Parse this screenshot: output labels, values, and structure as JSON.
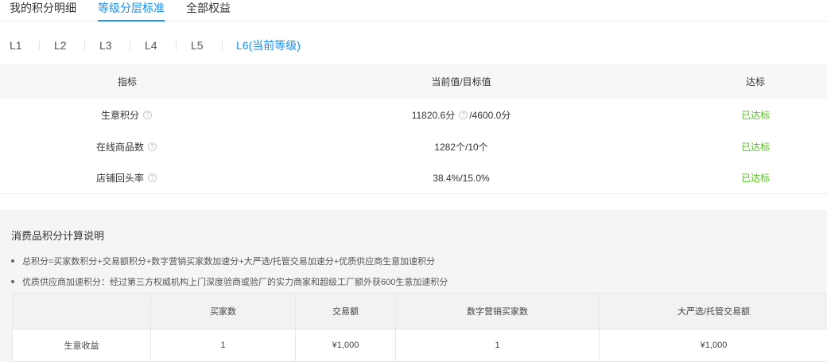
{
  "top_tabs": [
    "我的积分明细",
    "等级分层标准",
    "全部权益"
  ],
  "level_tabs": [
    "L1",
    "L2",
    "L3",
    "L4",
    "L5",
    "L6(当前等级)"
  ],
  "metrics": {
    "headers": [
      "指标",
      "当前值/目标值",
      "达标"
    ],
    "rows": [
      {
        "name": "生意积分",
        "value_current": "11820.6分",
        "value_target": "/4600.0分",
        "status": "已达标"
      },
      {
        "name": "在线商品数",
        "value": "1282个/10个",
        "status": "已达标"
      },
      {
        "name": "店铺回头率",
        "value": "38.4%/15.0%",
        "status": "已达标"
      }
    ]
  },
  "explanation": {
    "title": "消费品积分计算说明",
    "bullets": [
      "总积分=买家数积分+交易额积分+数字营销买家数加速分+大严选/托管交易加速分+优质供应商生意加速积分",
      "优质供应商加速积分：经过第三方权威机构上门深度验商或验厂的实力商家和超级工厂额外获600生意加速积分"
    ],
    "table": {
      "headers": [
        "",
        "买家数",
        "交易额",
        "数字营销买家数",
        "大严选/托管交易额"
      ],
      "rows": [
        [
          "生意收益",
          "1",
          "¥1,000",
          "1",
          "¥1,000"
        ]
      ]
    }
  },
  "colors": {
    "accent": "#1890ff",
    "success": "#52c41a"
  }
}
